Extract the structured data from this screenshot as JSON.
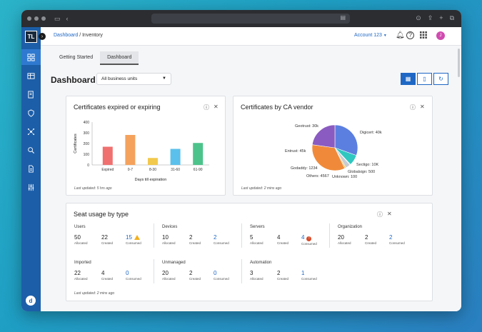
{
  "breadcrumb": {
    "root": "Dashboard",
    "sep": "/",
    "current": "Inventory"
  },
  "account": {
    "label": "Account 123"
  },
  "user": {
    "initial": "J"
  },
  "sidebar": {
    "logo": "TL",
    "user_initial": "d"
  },
  "tabs": [
    {
      "label": "Getting Started"
    },
    {
      "label": "Dashboard"
    }
  ],
  "page": {
    "title": "Dashboard",
    "business_unit": "All business units"
  },
  "colors": {
    "accent": "#1e67c4",
    "sidebar": "#1c5ea8"
  },
  "cert_card": {
    "title": "Certificates expired or expiring",
    "updated": "Last updated: 5 hrs ago"
  },
  "vendor_card": {
    "title": "Certificates by CA vendor",
    "updated": "Last updated: 2 mins ago"
  },
  "chart_data": [
    {
      "type": "bar",
      "title": "Certificates expired or expiring",
      "xlabel": "Days till expiration",
      "ylabel": "Certificates",
      "ylim": [
        0,
        400
      ],
      "yticks": [
        0,
        100,
        200,
        300,
        400
      ],
      "categories": [
        "Expired",
        "0-7",
        "8-30",
        "31-60",
        "61-90"
      ],
      "values": [
        170,
        280,
        65,
        150,
        205
      ],
      "colors": [
        "#f07070",
        "#f5a25d",
        "#f2c94c",
        "#5bc0eb",
        "#4cc38a"
      ]
    },
    {
      "type": "pie",
      "title": "Certificates by CA vendor",
      "slices": [
        {
          "label": "Digicert: 40k",
          "value": 40000,
          "color": "#5b7fe0"
        },
        {
          "label": "Sectigo: 10K",
          "value": 10000,
          "color": "#2fc7c0"
        },
        {
          "label": "Globalsign: 500",
          "value": 500,
          "color": "#1e9fa8"
        },
        {
          "label": "Unknown: 100",
          "value": 100,
          "color": "#6f7c8a"
        },
        {
          "label": "Others: 4567",
          "value": 4567,
          "color": "#c9cbd0"
        },
        {
          "label": "Godaddy: 1234",
          "value": 1234,
          "color": "#f0c14b"
        },
        {
          "label": "Entrust: 45k",
          "value": 45000,
          "color": "#f08a3a"
        },
        {
          "label": "Geotrust: 30k",
          "value": 30000,
          "color": "#8a5bc0"
        }
      ]
    }
  ],
  "pie_labels": {
    "geotrust": "Geotrust: 30k",
    "digicert": "Digicert: 40k",
    "entrust": "Entrust: 45k",
    "sectigo": "Sectigo: 10K",
    "globalsign": "Globalsign: 500",
    "godaddy": "Godaddy: 1234",
    "others": "Others: 4567",
    "unknown": "Unknown: 100"
  },
  "seat_card": {
    "title": "Seat usage by type",
    "updated": "Last updated: 2 mins ago",
    "sub_allocated": "Allocated",
    "sub_created": "Created",
    "sub_consumed": "Consumed",
    "groups": [
      {
        "label": "Users",
        "allocated": "50",
        "created": "22",
        "consumed": "15",
        "flag": "warn"
      },
      {
        "label": "Devices",
        "allocated": "10",
        "created": "2",
        "consumed": "2",
        "flag": ""
      },
      {
        "label": "Servers",
        "allocated": "5",
        "created": "4",
        "consumed": "4",
        "flag": "error"
      },
      {
        "label": "Organization",
        "allocated": "20",
        "created": "2",
        "consumed": "2",
        "flag": ""
      },
      {
        "label": "Imported",
        "allocated": "22",
        "created": "4",
        "consumed": "0",
        "flag": ""
      },
      {
        "label": "Unmanaged",
        "allocated": "20",
        "created": "2",
        "consumed": "0",
        "flag": ""
      },
      {
        "label": "Automation",
        "allocated": "3",
        "created": "2",
        "consumed": "1",
        "flag": ""
      }
    ]
  }
}
